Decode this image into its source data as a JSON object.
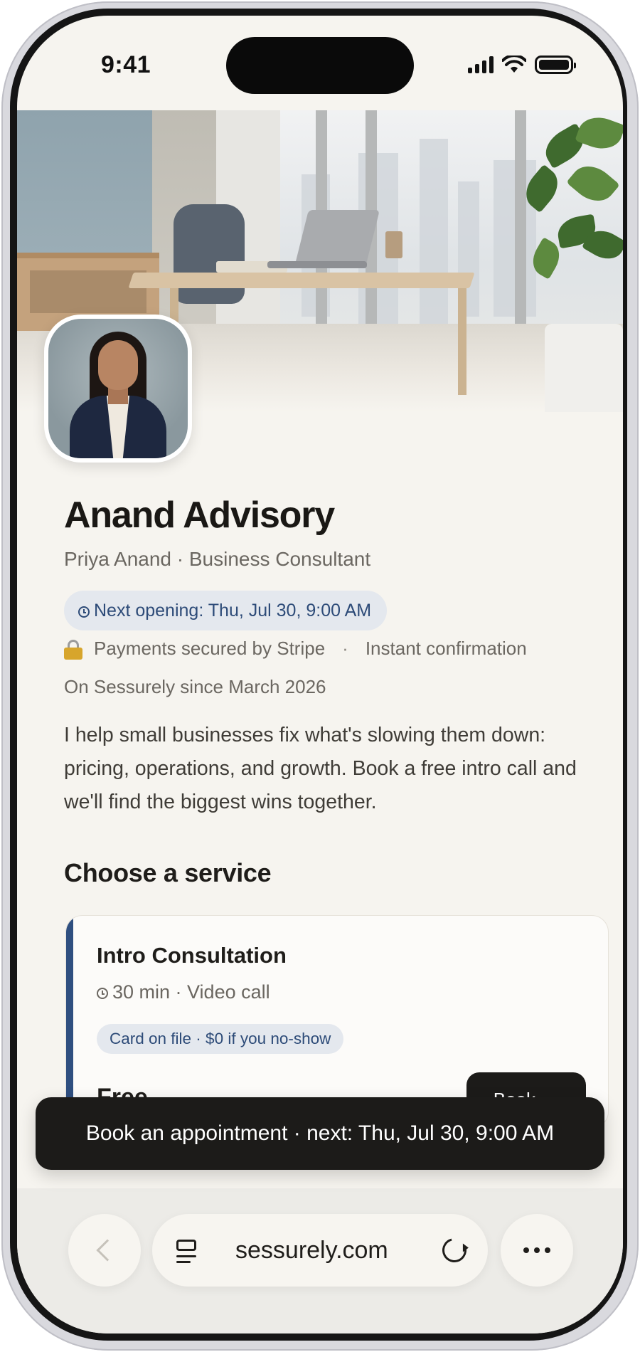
{
  "status_bar": {
    "time": "9:41"
  },
  "business": {
    "name": "Anand Advisory",
    "subtitle": "Priya Anand · Business Consultant",
    "next_opening": "Next opening: Thu, Jul 30, 9:00 AM",
    "trust": {
      "payments": "Payments secured by Stripe",
      "separator": "·",
      "confirmation": "Instant confirmation"
    },
    "member_since": "On Sessurely since March 2026",
    "bio": "I help small businesses fix what's slowing them down: pricing, operations, and growth. Book a free intro call and we'll find the biggest wins together."
  },
  "services": {
    "section_title": "Choose a service",
    "items": [
      {
        "name": "Intro Consultation",
        "meta": "30 min · Video call",
        "policy": "Card on file · $0 if you no-show",
        "price": "Free",
        "book_label": "Book →"
      }
    ]
  },
  "cta": {
    "label": "Book an appointment · next: Thu, Jul 30, 9:00 AM"
  },
  "browser": {
    "url": "sessurely.com"
  },
  "icons": {
    "clock": "clock-icon",
    "lock": "lock-icon",
    "back": "chevron-left-icon",
    "reader": "reader-mode-icon",
    "reload": "reload-icon",
    "more": "more-icon"
  },
  "colors": {
    "accent": "#2f4f80",
    "badge_bg": "#e4e8ee",
    "button_dark": "#1c1b19",
    "page_bg": "#f6f4ef"
  }
}
